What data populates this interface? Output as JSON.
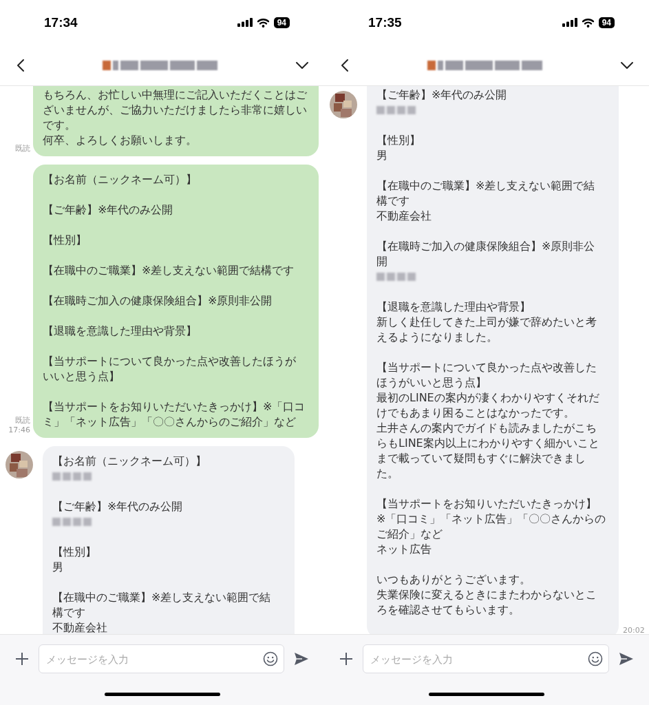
{
  "phones": [
    {
      "status_bar": {
        "time": "17:34",
        "battery": "94"
      },
      "messages": [
        {
          "kind": "sent",
          "continued_from_above": true,
          "read_label": "既読",
          "paragraphs": [
            {
              "lines": [
                "もちろん、お忙しい中無理にご記入いただくことはご",
                "ざいませんが、ご協力いただけましたら非常に嬉しい",
                "です。",
                "何卒、よろしくお願いします。"
              ],
              "redacted": false
            }
          ]
        },
        {
          "kind": "sent",
          "continued_from_above": false,
          "read_label": "既読",
          "time": "17:46",
          "paragraphs": [
            {
              "lines": [
                "【お名前（ニックネーム可）】"
              ],
              "redacted": false
            },
            {
              "lines": [
                "【ご年齢】※年代のみ公開"
              ],
              "redacted": false
            },
            {
              "lines": [
                "【性別】"
              ],
              "redacted": false
            },
            {
              "lines": [
                "【在職中のご職業】※差し支えない範囲で結構です"
              ],
              "redacted": false
            },
            {
              "lines": [
                "【在職時ご加入の健康保険組合】※原則非公開"
              ],
              "redacted": false
            },
            {
              "lines": [
                "【退職を意識した理由や背景】"
              ],
              "redacted": false
            },
            {
              "lines": [
                "【当サポートについて良かった点や改善したほうが",
                "いいと思う点】"
              ],
              "redacted": false
            },
            {
              "lines": [
                "【当サポートをお知りいただいたきっかけ】※「口コ",
                "ミ」「ネット広告」「〇〇さんからのご紹介」など"
              ],
              "redacted": false
            }
          ]
        },
        {
          "kind": "received",
          "continued_from_above": false,
          "paragraphs": [
            {
              "lines": [
                "【お名前（ニックネーム可）】"
              ],
              "redacted": true
            },
            {
              "lines": [
                "【ご年齢】※年代のみ公開"
              ],
              "redacted": true
            },
            {
              "lines": [
                "【性別】",
                "男"
              ],
              "redacted": false
            },
            {
              "lines": [
                "【在職中のご職業】※差し支えない範囲で結",
                "構です",
                "不動産会社"
              ],
              "redacted": false
            }
          ]
        }
      ],
      "input": {
        "placeholder": "メッセージを入力"
      }
    },
    {
      "status_bar": {
        "time": "17:35",
        "battery": "94"
      },
      "messages": [
        {
          "kind": "received",
          "continued_from_above": true,
          "time": "20:02",
          "paragraphs": [
            {
              "lines": [
                "【ご年齢】※年代のみ公開"
              ],
              "redacted": true
            },
            {
              "lines": [
                "【性別】",
                "男"
              ],
              "redacted": false
            },
            {
              "lines": [
                "【在職中のご職業】※差し支えない範囲で結",
                "構です",
                "不動産会社"
              ],
              "redacted": false
            },
            {
              "lines": [
                "【在職時ご加入の健康保険組合】※原則非公",
                "開"
              ],
              "redacted": true
            },
            {
              "lines": [
                "【退職を意識した理由や背景】",
                "新しく赴任してきた上司が嫌で辞めたいと考",
                "えるようになりました。"
              ],
              "redacted": false
            },
            {
              "lines": [
                "【当サポートについて良かった点や改善した",
                "ほうがいいと思う点】",
                "最初のLINEの案内が凄くわかりやすくそれだ",
                "けでもあまり困ることはなかったです。",
                "土井さんの案内でガイドも読みましたがこち",
                "らもLINE案内以上にわかりやすく細かいこと",
                "まで載っていて疑問もすぐに解決できまし",
                "た。"
              ],
              "redacted": false
            },
            {
              "lines": [
                "【当サポートをお知りいただいたきっかけ】",
                "※「口コミ」「ネット広告」「〇〇さんからの",
                "ご紹介」など",
                "ネット広告"
              ],
              "redacted": false
            },
            {
              "lines": [
                "いつもありがとうございます。",
                "失業保険に変えるときにまたわからないとこ",
                "ろを確認させてもらいます。"
              ],
              "redacted": false
            }
          ]
        }
      ],
      "input": {
        "placeholder": "メッセージを入力"
      }
    }
  ]
}
